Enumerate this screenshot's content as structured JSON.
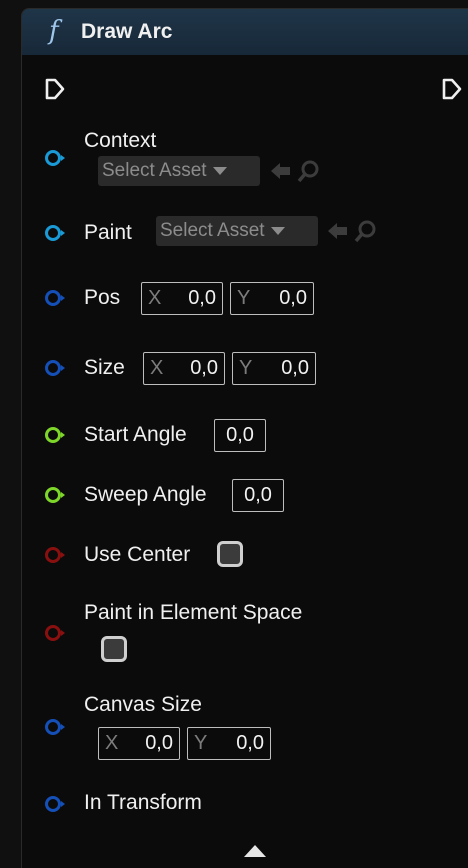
{
  "node": {
    "title": "Draw Arc",
    "icon": "function-icon",
    "header_color": "#1f3548"
  },
  "pins": {
    "context": {
      "label": "Context",
      "asset": "Select Asset",
      "color": "#1a9ad6"
    },
    "paint": {
      "label": "Paint",
      "asset": "Select Asset",
      "color": "#1a9ad6"
    },
    "pos": {
      "label": "Pos",
      "x_axis": "X",
      "x_value": "0,0",
      "y_axis": "Y",
      "y_value": "0,0",
      "color": "#1450b8"
    },
    "size": {
      "label": "Size",
      "x_axis": "X",
      "x_value": "0,0",
      "y_axis": "Y",
      "y_value": "0,0",
      "color": "#1450b8"
    },
    "start_angle": {
      "label": "Start Angle",
      "value": "0,0",
      "color": "#7fd62a"
    },
    "sweep_angle": {
      "label": "Sweep Angle",
      "value": "0,0",
      "color": "#7fd62a"
    },
    "use_center": {
      "label": "Use Center",
      "color": "#8a1010"
    },
    "paint_in_element_space": {
      "label": "Paint in Element Space",
      "color": "#8a1010"
    },
    "canvas_size": {
      "label": "Canvas Size",
      "x_axis": "X",
      "x_value": "0,0",
      "y_axis": "Y",
      "y_value": "0,0",
      "color": "#1450b8"
    },
    "in_transform": {
      "label": "In Transform",
      "color": "#1450b8"
    }
  }
}
